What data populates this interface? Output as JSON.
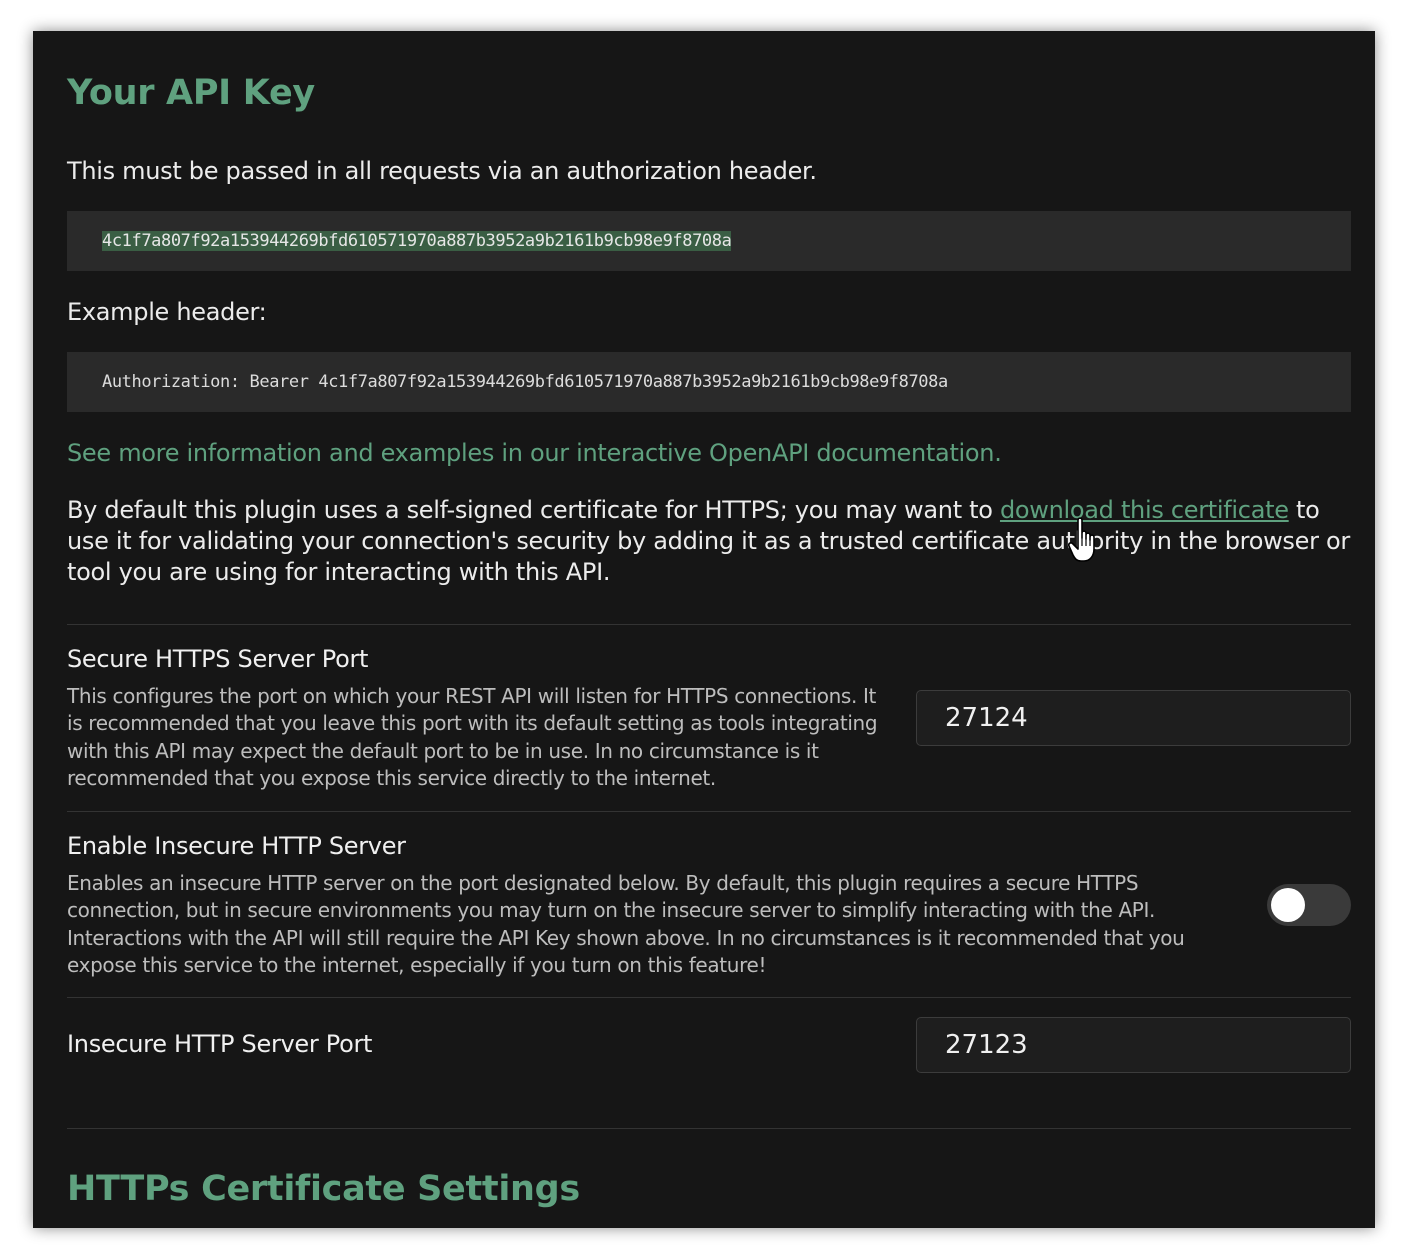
{
  "api_key_section": {
    "title": "Your API Key",
    "intro": "This must be passed in all requests via an authorization header.",
    "api_key": "4c1f7a807f92a153944269bfd610571970a887b3952a9b2161b9cb98e9f8708a",
    "example_label": "Example header:",
    "example_header": "Authorization: Bearer 4c1f7a807f92a153944269bfd610571970a887b3952a9b2161b9cb98e9f8708a",
    "docs_link": "See more information and examples in our interactive OpenAPI documentation.",
    "cert_text_before": "By default this plugin uses a self-signed certificate for HTTPS; you may want to ",
    "cert_link": "download this certificate",
    "cert_text_after": " to use it for validating your connection's security by adding it as a trusted certificate authority in the browser or tool you are using for interacting with this API."
  },
  "settings": {
    "https_port": {
      "name": "Secure HTTPS Server Port",
      "description": "This configures the port on which your REST API will listen for HTTPS connections. It is recommended that you leave this port with its default setting as tools integrating with this API may expect the default port to be in use. In no circumstance is it recommended that you expose this service directly to the internet.",
      "value": "27124"
    },
    "insecure_server": {
      "name": "Enable Insecure HTTP Server",
      "description": "Enables an insecure HTTP server on the port designated below. By default, this plugin requires a secure HTTPS connection, but in secure environments you may turn on the insecure server to simplify interacting with the API. Interactions with the API will still require the API Key shown above. In no circumstances is it recommended that you expose this service to the internet, especially if you turn on this feature!",
      "enabled": false
    },
    "http_port": {
      "name": "Insecure HTTP Server Port",
      "value": "27123"
    }
  },
  "certificate_section": {
    "title": "HTTPs Certificate Settings"
  },
  "colors": {
    "accent": "#5fa17f",
    "background": "#161616",
    "code_background": "#2a2a2a",
    "selection": "#3a5e44"
  },
  "cursor": "hand-pointer-icon"
}
